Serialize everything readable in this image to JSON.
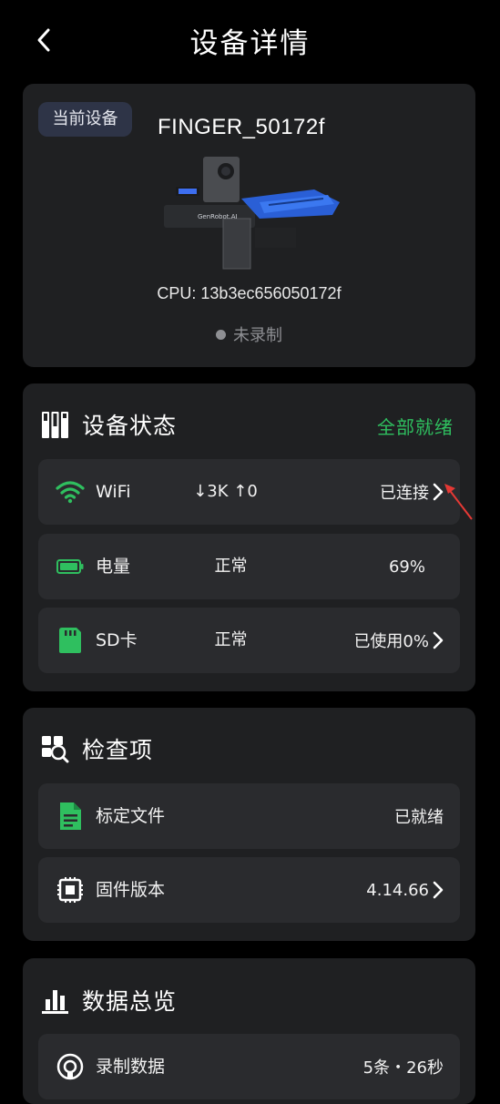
{
  "header": {
    "title": "设备详情",
    "back_icon": "back-arrow-icon"
  },
  "device": {
    "badge": "当前设备",
    "name": "FINGER_50172f",
    "image_label": "GenRobot.AI",
    "cpu": "CPU: 13b3ec656050172f",
    "record_status": "未录制"
  },
  "status_section": {
    "title": "设备状态",
    "summary": "全部就绪",
    "summary_color": "#2fbf5f",
    "rows": [
      {
        "icon": "wifi-icon",
        "label": "WiFi",
        "mid": "↓3K ↑0",
        "right": "已连接",
        "has_chevron": true
      },
      {
        "icon": "battery-icon",
        "label": "电量",
        "mid": "正常",
        "right": "69%",
        "has_chevron": false
      },
      {
        "icon": "sd-card-icon",
        "label": "SD卡",
        "mid": "正常",
        "right": "已使用0%",
        "has_chevron": true
      }
    ]
  },
  "check_section": {
    "title": "检查项",
    "rows": [
      {
        "icon": "document-icon",
        "label": "标定文件",
        "right": "已就绪",
        "has_chevron": false
      },
      {
        "icon": "chip-icon",
        "label": "固件版本",
        "right": "4.14.66",
        "has_chevron": true
      }
    ]
  },
  "data_section": {
    "title": "数据总览",
    "rows": [
      {
        "icon": "record-icon",
        "label": "录制数据",
        "right": "5条・26秒"
      }
    ]
  },
  "colors": {
    "accent_green": "#2fbf5f",
    "card_bg": "#1f2022",
    "row_bg": "#2a2b2e",
    "annotation_arrow": "#e53935"
  }
}
